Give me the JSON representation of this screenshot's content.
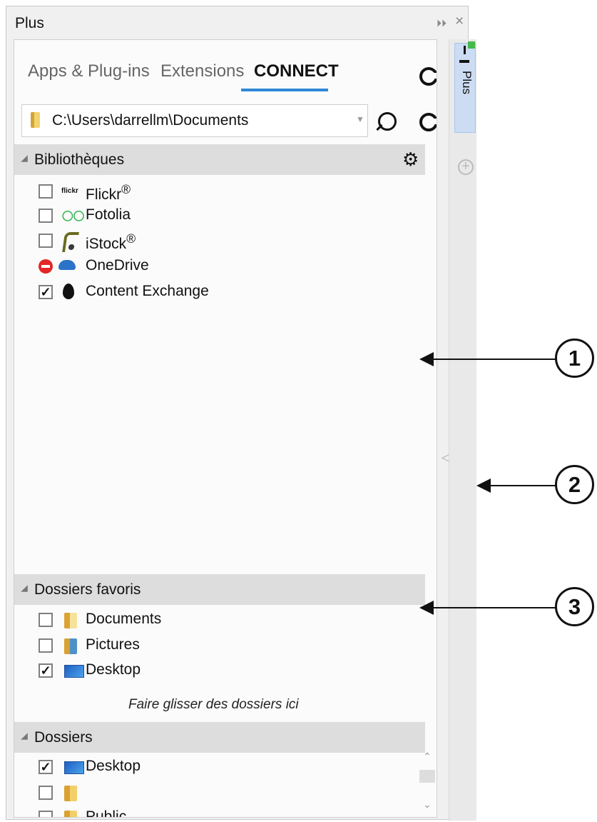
{
  "window": {
    "title": "Plus",
    "pin_icon": "pin-icon",
    "close_icon": "close-icon"
  },
  "tabs": [
    {
      "label": "Apps & Plug-ins",
      "active": false
    },
    {
      "label": "Extensions",
      "active": false
    },
    {
      "label": "CONNECT",
      "active": true
    }
  ],
  "toolbar": {
    "refresh_icon": "refresh-icon"
  },
  "path": {
    "value": "C:\\Users\\darrellm\\Documents",
    "dropdown_icon": "chevron-down-icon",
    "search_icon": "search-icon",
    "refresh_icon": "refresh-icon"
  },
  "libraries": {
    "header": "Bibliothèques",
    "settings_icon": "gear-icon",
    "items": [
      {
        "label": "Flickr",
        "trademark": "®",
        "checked": false,
        "blocked": false,
        "icon": "flickr-icon",
        "icon_text": "flickr"
      },
      {
        "label": "Fotolia",
        "checked": false,
        "blocked": false,
        "icon": "fotolia-icon"
      },
      {
        "label": "iStock",
        "trademark": "®",
        "checked": false,
        "blocked": false,
        "icon": "istock-icon"
      },
      {
        "label": "OneDrive",
        "checked": false,
        "blocked": true,
        "icon": "onedrive-icon"
      },
      {
        "label": "Content Exchange",
        "checked": true,
        "blocked": false,
        "icon": "content-exchange-icon"
      }
    ]
  },
  "favorite_folders": {
    "header": "Dossiers favoris",
    "items": [
      {
        "label": "Documents",
        "checked": false,
        "icon": "documents-folder-icon"
      },
      {
        "label": "Pictures",
        "checked": false,
        "icon": "pictures-folder-icon"
      },
      {
        "label": "Desktop",
        "checked": true,
        "icon": "desktop-icon"
      }
    ],
    "drop_hint": "Faire glisser des dossiers ici"
  },
  "folders": {
    "header": "Dossiers",
    "items": [
      {
        "label": "Desktop",
        "checked": true,
        "icon": "desktop-icon"
      },
      {
        "label": "",
        "checked": false,
        "icon": "user-folder-icon"
      },
      {
        "label": "Public",
        "checked": false,
        "icon": "public-folder-icon"
      }
    ]
  },
  "side_tab": {
    "label": "Plus",
    "icon": "download-plus-icon",
    "add_icon": "add-icon"
  },
  "callouts": [
    "1",
    "2",
    "3"
  ],
  "colors": {
    "accent": "#2f88d8",
    "section_header": "#dddddd",
    "side_tab": "#ccdcf3",
    "check": "#111111"
  }
}
